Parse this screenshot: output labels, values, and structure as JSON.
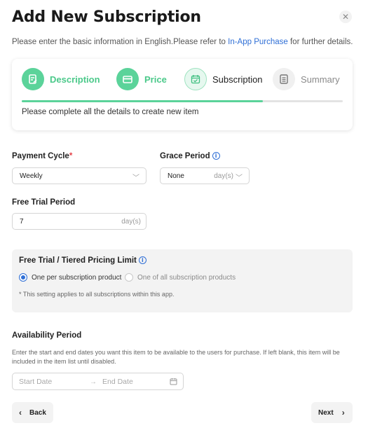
{
  "header": {
    "title": "Add New Subscription",
    "close_icon": "close-icon",
    "intro_prefix": "Please enter the basic information in English.Please refer to ",
    "intro_link": "In-App Purchase",
    "intro_suffix": " for further details."
  },
  "steps": {
    "items": [
      {
        "label": "Description",
        "state": "done",
        "icon": "document-edit-icon"
      },
      {
        "label": "Price",
        "state": "done",
        "icon": "card-icon"
      },
      {
        "label": "Subscription",
        "state": "active",
        "icon": "calendar-check-icon"
      },
      {
        "label": "Summary",
        "state": "pending",
        "icon": "list-doc-icon"
      }
    ],
    "progress_percent": 75,
    "hint": "Please complete all the details to create new item"
  },
  "payment_cycle": {
    "label": "Payment Cycle",
    "required_mark": "*",
    "value": "Weekly"
  },
  "grace_period": {
    "label": "Grace Period",
    "value": "None",
    "unit": "day(s)"
  },
  "free_trial": {
    "label": "Free Trial Period",
    "value": "7",
    "unit": "day(s)"
  },
  "pricing_limit": {
    "title": "Free Trial / Tiered Pricing Limit",
    "options": [
      {
        "label": "One per subscription product",
        "selected": true
      },
      {
        "label": "One of all subscription products",
        "selected": false
      }
    ],
    "note": "* This setting applies to all subscriptions within this app."
  },
  "availability": {
    "title": "Availability Period",
    "description": "Enter the start and end dates you want this item to be available to the users for purchase. If left blank, this item will be included in the item list until disabled.",
    "start_placeholder": "Start Date",
    "end_placeholder": "End Date"
  },
  "footer": {
    "back_label": "Back",
    "next_label": "Next"
  },
  "colors": {
    "accent_green": "#5bd39a",
    "link_blue": "#2f6fd6",
    "required_red": "#e5434a"
  }
}
